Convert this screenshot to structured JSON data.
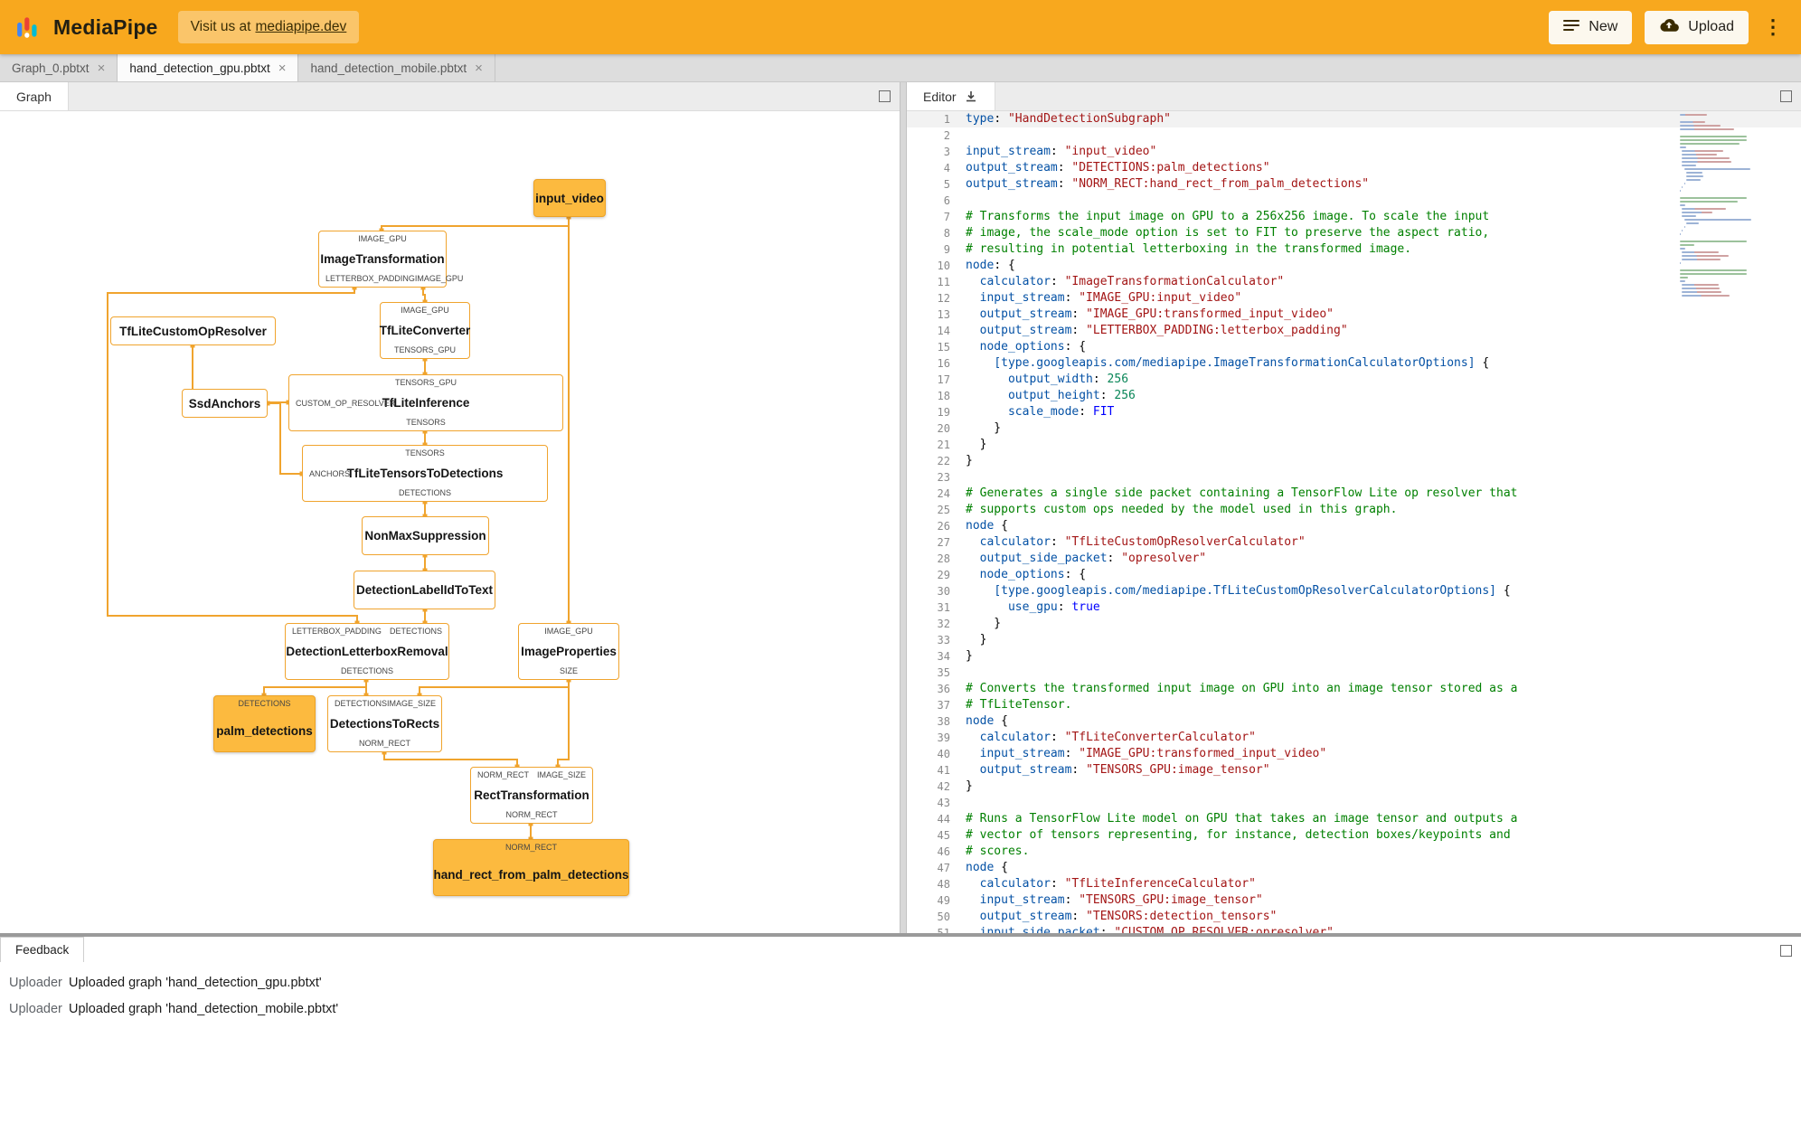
{
  "header": {
    "app_title": "MediaPipe",
    "visit_prefix": "Visit us at",
    "visit_link": "mediapipe.dev",
    "new_button": "New",
    "upload_button": "Upload"
  },
  "icons": {
    "close": "×",
    "kebab": "⋮"
  },
  "tabs": [
    {
      "label": "Graph_0.pbtxt",
      "active": false
    },
    {
      "label": "hand_detection_gpu.pbtxt",
      "active": true
    },
    {
      "label": "hand_detection_mobile.pbtxt",
      "active": false
    }
  ],
  "graph_panel": {
    "tab_label": "Graph"
  },
  "editor_panel": {
    "tab_label": "Editor"
  },
  "feedback_panel": {
    "tab_label": "Feedback",
    "entries": [
      {
        "source": "Uploader",
        "message": "Uploaded graph 'hand_detection_gpu.pbtxt'"
      },
      {
        "source": "Uploader",
        "message": "Uploaded graph 'hand_detection_mobile.pbtxt'"
      }
    ]
  },
  "graph": {
    "nodes": {
      "input_video": {
        "label": "input_video",
        "type": "stream"
      },
      "image_transformation": {
        "label": "ImageTransformation",
        "ports": {
          "top": "IMAGE_GPU",
          "bottom_left": "LETTERBOX_PADDING",
          "bottom_right": "IMAGE_GPU"
        }
      },
      "tflite_converter": {
        "label": "TfLiteConverter",
        "ports": {
          "top": "IMAGE_GPU",
          "bottom": "TENSORS_GPU"
        }
      },
      "tflite_custom_op_resolver": {
        "label": "TfLiteCustomOpResolver"
      },
      "ssd_anchors": {
        "label": "SsdAnchors"
      },
      "tflite_inference": {
        "label": "TfLiteInference",
        "ports": {
          "top": "TENSORS_GPU",
          "left": "CUSTOM_OP_RESOLVER",
          "bottom": "TENSORS"
        }
      },
      "tflite_tensors_to_detections": {
        "label": "TfLiteTensorsToDetections",
        "ports": {
          "top": "TENSORS",
          "left": "ANCHORS",
          "bottom": "DETECTIONS"
        }
      },
      "non_max_suppression": {
        "label": "NonMaxSuppression"
      },
      "detection_label_id_to_text": {
        "label": "DetectionLabelIdToText"
      },
      "detection_letterbox_removal": {
        "label": "DetectionLetterboxRemoval",
        "ports": {
          "top_left": "LETTERBOX_PADDING",
          "top_right": "DETECTIONS",
          "bottom": "DETECTIONS"
        }
      },
      "image_properties": {
        "label": "ImageProperties",
        "ports": {
          "top": "IMAGE_GPU",
          "bottom": "SIZE"
        }
      },
      "palm_detections": {
        "label": "palm_detections",
        "type": "stream",
        "ports": {
          "top": "DETECTIONS"
        }
      },
      "detections_to_rects": {
        "label": "DetectionsToRects",
        "ports": {
          "top_left": "DETECTIONS",
          "top_right": "IMAGE_SIZE",
          "bottom": "NORM_RECT"
        }
      },
      "rect_transformation": {
        "label": "RectTransformation",
        "ports": {
          "top_left": "NORM_RECT",
          "top_right": "IMAGE_SIZE",
          "bottom": "NORM_RECT"
        }
      },
      "hand_rect_from_palm_detections": {
        "label": "hand_rect_from_palm_detections",
        "type": "stream",
        "ports": {
          "top": "NORM_RECT"
        }
      }
    }
  },
  "editor": {
    "code_lines": [
      "type: \"HandDetectionSubgraph\"",
      "",
      "input_stream: \"input_video\"",
      "output_stream: \"DETECTIONS:palm_detections\"",
      "output_stream: \"NORM_RECT:hand_rect_from_palm_detections\"",
      "",
      "# Transforms the input image on GPU to a 256x256 image. To scale the input",
      "# image, the scale_mode option is set to FIT to preserve the aspect ratio,",
      "# resulting in potential letterboxing in the transformed image.",
      "node: {",
      "  calculator: \"ImageTransformationCalculator\"",
      "  input_stream: \"IMAGE_GPU:input_video\"",
      "  output_stream: \"IMAGE_GPU:transformed_input_video\"",
      "  output_stream: \"LETTERBOX_PADDING:letterbox_padding\"",
      "  node_options: {",
      "    [type.googleapis.com/mediapipe.ImageTransformationCalculatorOptions] {",
      "      output_width: 256",
      "      output_height: 256",
      "      scale_mode: FIT",
      "    }",
      "  }",
      "}",
      "",
      "# Generates a single side packet containing a TensorFlow Lite op resolver that",
      "# supports custom ops needed by the model used in this graph.",
      "node {",
      "  calculator: \"TfLiteCustomOpResolverCalculator\"",
      "  output_side_packet: \"opresolver\"",
      "  node_options: {",
      "    [type.googleapis.com/mediapipe.TfLiteCustomOpResolverCalculatorOptions] {",
      "      use_gpu: true",
      "    }",
      "  }",
      "}",
      "",
      "# Converts the transformed input image on GPU into an image tensor stored as a",
      "# TfLiteTensor.",
      "node {",
      "  calculator: \"TfLiteConverterCalculator\"",
      "  input_stream: \"IMAGE_GPU:transformed_input_video\"",
      "  output_stream: \"TENSORS_GPU:image_tensor\"",
      "}",
      "",
      "# Runs a TensorFlow Lite model on GPU that takes an image tensor and outputs a",
      "# vector of tensors representing, for instance, detection boxes/keypoints and",
      "# scores.",
      "node {",
      "  calculator: \"TfLiteInferenceCalculator\"",
      "  input_stream: \"TENSORS_GPU:image_tensor\"",
      "  output_stream: \"TENSORS:detection_tensors\"",
      "  input_side_packet: \"CUSTOM_OP_RESOLVER:opresolver\""
    ]
  },
  "colors": {
    "header_background": "#F8A81E",
    "node_accent": "#F0A42E",
    "stream_node_fill": "#FCBA3F",
    "code_key": "#0451A5",
    "code_string": "#A31515",
    "code_comment": "#008000",
    "code_number": "#098658",
    "code_keyword": "#0000FF"
  }
}
